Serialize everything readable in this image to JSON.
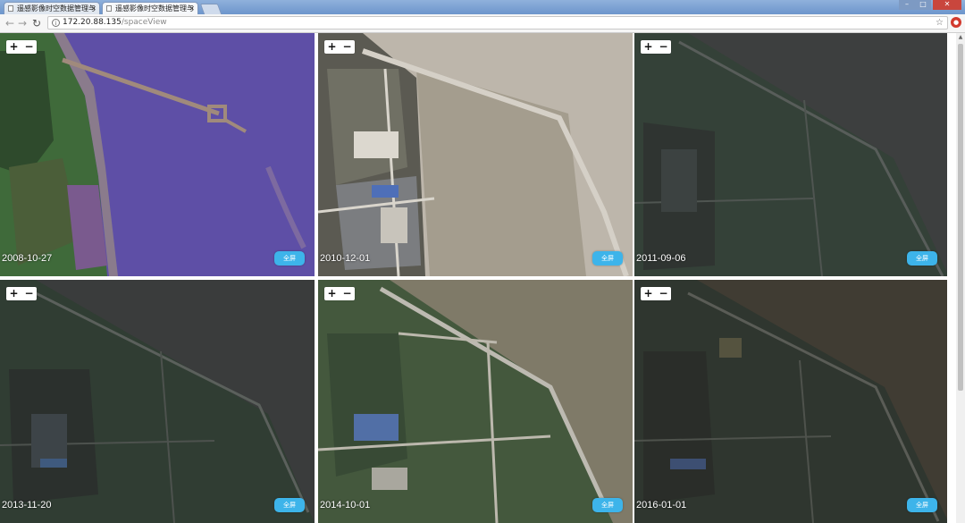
{
  "browser": {
    "tabs": [
      {
        "title": "遥感影像时空数据管理与"
      },
      {
        "title": "遥感影像时空数据管理与"
      }
    ],
    "address": {
      "host": "172.20.88.135",
      "path": "/spaceView"
    }
  },
  "map": {
    "zoom_in": "+",
    "zoom_out": "−",
    "fullscreen_label": "全屏",
    "tiles": [
      {
        "date": "2008-10-27"
      },
      {
        "date": "2010-12-01"
      },
      {
        "date": "2011-09-06"
      },
      {
        "date": "2013-11-20"
      },
      {
        "date": "2014-10-01"
      },
      {
        "date": "2016-01-01"
      }
    ]
  },
  "icons": {
    "back": "back-arrow-icon",
    "forward": "forward-arrow-icon",
    "reload": "reload-icon",
    "info": "info-icon",
    "star": "bookmark-star-icon",
    "extension": "extension-icon"
  }
}
